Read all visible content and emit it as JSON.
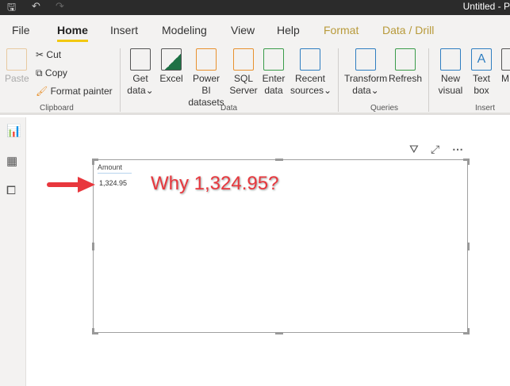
{
  "title": "Untitled - P",
  "tabs": [
    {
      "label": "File"
    },
    {
      "label": "Home"
    },
    {
      "label": "Insert"
    },
    {
      "label": "Modeling"
    },
    {
      "label": "View"
    },
    {
      "label": "Help"
    },
    {
      "label": "Format"
    },
    {
      "label": "Data / Drill"
    }
  ],
  "clipboard": {
    "paste": "Paste",
    "cut": "Cut",
    "copy": "Copy",
    "format_painter": "Format painter",
    "group": "Clipboard"
  },
  "data": {
    "get_data": [
      "Get",
      "data"
    ],
    "excel": "Excel",
    "pbi": [
      "Power BI",
      "datasets"
    ],
    "sql": [
      "SQL",
      "Server"
    ],
    "enter": [
      "Enter",
      "data"
    ],
    "recent": [
      "Recent",
      "sources"
    ],
    "group": "Data"
  },
  "queries": {
    "transform": [
      "Transform",
      "data"
    ],
    "refresh": "Refresh",
    "group": "Queries"
  },
  "insert": {
    "new_visual": [
      "New",
      "visual"
    ],
    "text_box": [
      "Text",
      "box"
    ],
    "more": "M",
    "group": "Insert"
  },
  "table": {
    "header": "Amount",
    "value": "1,324.95"
  },
  "annotation": "Why 1,324.95?",
  "colors": {
    "accent": "#f2c811",
    "annotation": "#e8373d",
    "excel": "#1e7145"
  }
}
